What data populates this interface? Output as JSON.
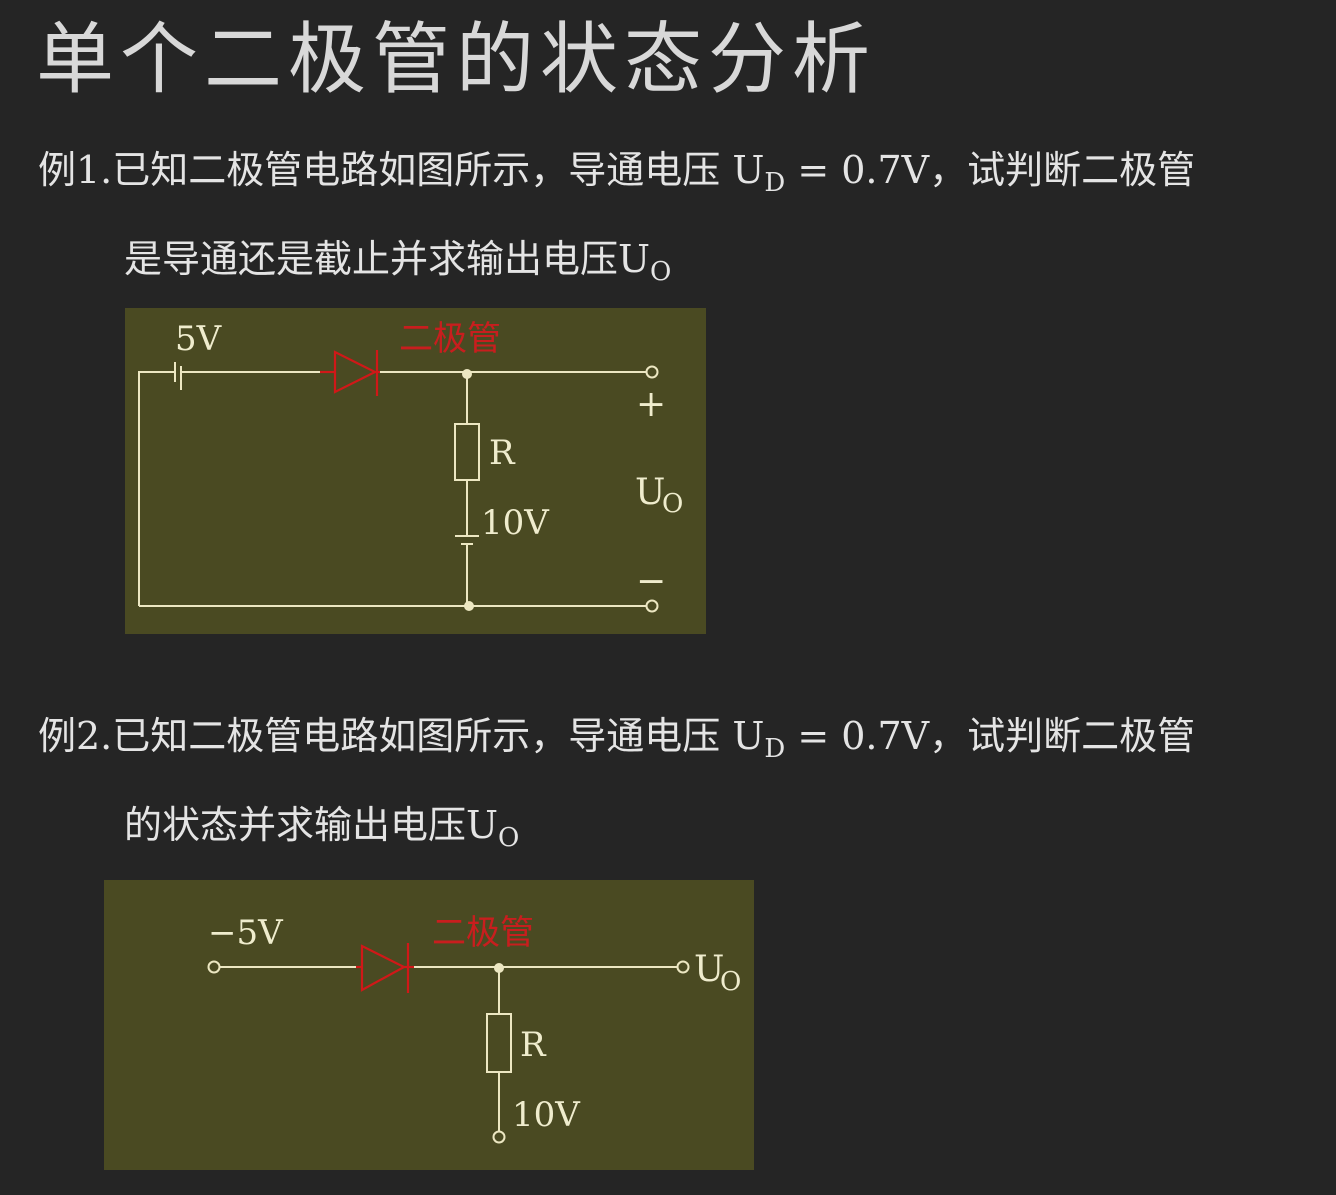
{
  "title": "单个二极管的状态分析",
  "example1": {
    "prefix": "例1.",
    "line1_a": "已知二极管电路如图所示，导通电压 U",
    "ud_sub": "D",
    "line1_b": " = 0.7V，试判断二极管",
    "line2_a": "是导通还是截止并求输出电压U",
    "uo_sub": "O"
  },
  "example2": {
    "prefix": "例2.",
    "line1_a": "已知二极管电路如图所示，导通电压 U",
    "ud_sub": "D",
    "line1_b": " = 0.7V，试判断二极管",
    "line2_a": "的状态并求输出电压U",
    "uo_sub": "O"
  },
  "circuit1": {
    "source_label": "5V",
    "diode_label": "二极管",
    "resistor_label": "R",
    "battery_label": "10V",
    "plus": "+",
    "minus": "−",
    "out_u": "U",
    "out_sub": "O"
  },
  "circuit2": {
    "source_label": "−5V",
    "diode_label": "二极管",
    "resistor_label": "R",
    "battery_label": "10V",
    "out_u": "U",
    "out_sub": "O"
  },
  "colors": {
    "background": "#252525",
    "panel": "#4a4a22",
    "wire": "#ece7c2",
    "diode": "#d01818",
    "label": "#efeccd"
  }
}
